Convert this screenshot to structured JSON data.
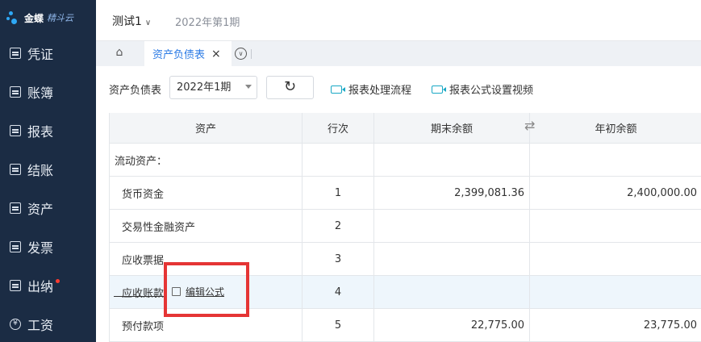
{
  "brand": {
    "name": "金蝶",
    "product": "精斗云"
  },
  "sidebar": {
    "items": [
      {
        "label": "凭证",
        "icon": "voucher-icon"
      },
      {
        "label": "账簿",
        "icon": "ledger-icon"
      },
      {
        "label": "报表",
        "icon": "report-icon"
      },
      {
        "label": "结账",
        "icon": "close-period-icon"
      },
      {
        "label": "资产",
        "icon": "asset-icon"
      },
      {
        "label": "发票",
        "icon": "invoice-icon"
      },
      {
        "label": "出纳",
        "icon": "cashier-icon",
        "badge": true
      },
      {
        "label": "工资",
        "icon": "salary-icon",
        "glyph": "¥"
      }
    ]
  },
  "header": {
    "account": "测试1",
    "period": "2022年第1期"
  },
  "tabs": {
    "active": "资产负债表"
  },
  "toolbar": {
    "report_label": "资产负债表",
    "period_select": "2022年1期",
    "link_flow": "报表处理流程",
    "link_formula_video": "报表公式设置视频"
  },
  "table": {
    "headers": [
      "资产",
      "行次",
      "期末余额",
      "年初余额"
    ],
    "rows": [
      {
        "item": "流动资产：",
        "line": "",
        "end": "",
        "begin": ""
      },
      {
        "item": "货币资金",
        "line": "1",
        "end": "2,399,081.36",
        "begin": "2,400,000.00"
      },
      {
        "item": "交易性金融资产",
        "line": "2",
        "end": "",
        "begin": ""
      },
      {
        "item": "应收票据",
        "line": "3",
        "end": "",
        "begin": ""
      },
      {
        "item": "应收账款",
        "line": "4",
        "end": "",
        "begin": ""
      },
      {
        "item": "预付款项",
        "line": "5",
        "end": "22,775.00",
        "begin": "23,775.00"
      }
    ]
  },
  "formula_link": "编辑公式",
  "colors": {
    "sidebar": "#1b2c44",
    "accent": "#2c7be5",
    "highlight_box": "#e53535"
  }
}
